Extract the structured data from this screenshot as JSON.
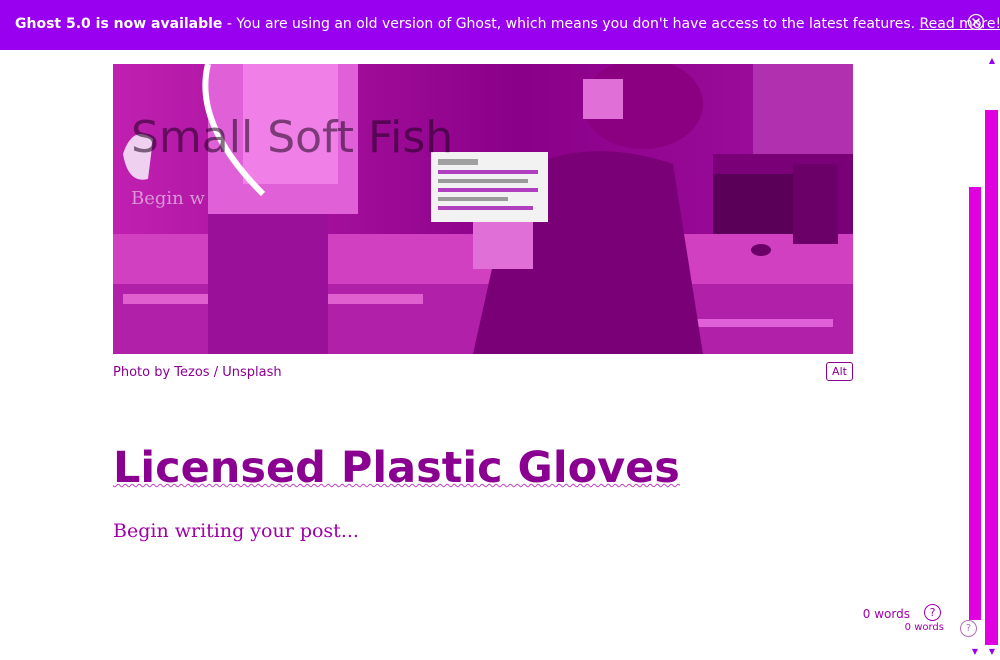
{
  "banner": {
    "bold_text": "Ghost 5.0 is now available",
    "message": " - You are using an old version of Ghost, which means you don't have access to the latest features. ",
    "link_label": "Read more!",
    "close_icon": "close-icon",
    "color": "#9a00f0"
  },
  "feature_image": {
    "overlay_title": "Small Soft Fish",
    "overlay_subtitle": "Begin w",
    "caption": "Photo by Tezos / Unsplash",
    "alt_label": "Alt"
  },
  "post": {
    "title": "Licensed Plastic Gloves",
    "body_placeholder": "Begin writing your post..."
  },
  "status": {
    "word_count": "0 words",
    "word_count_secondary": "0 words",
    "help_icon": "question-icon",
    "help_label": "?"
  },
  "scrollbar": {
    "up_icon": "scroll-up-icon",
    "down_icon": "scroll-down-icon",
    "up_glyph": "▲",
    "down_glyph": "▼"
  },
  "colors": {
    "accent": "#8a0090",
    "scrollbar": "#e000e0"
  }
}
